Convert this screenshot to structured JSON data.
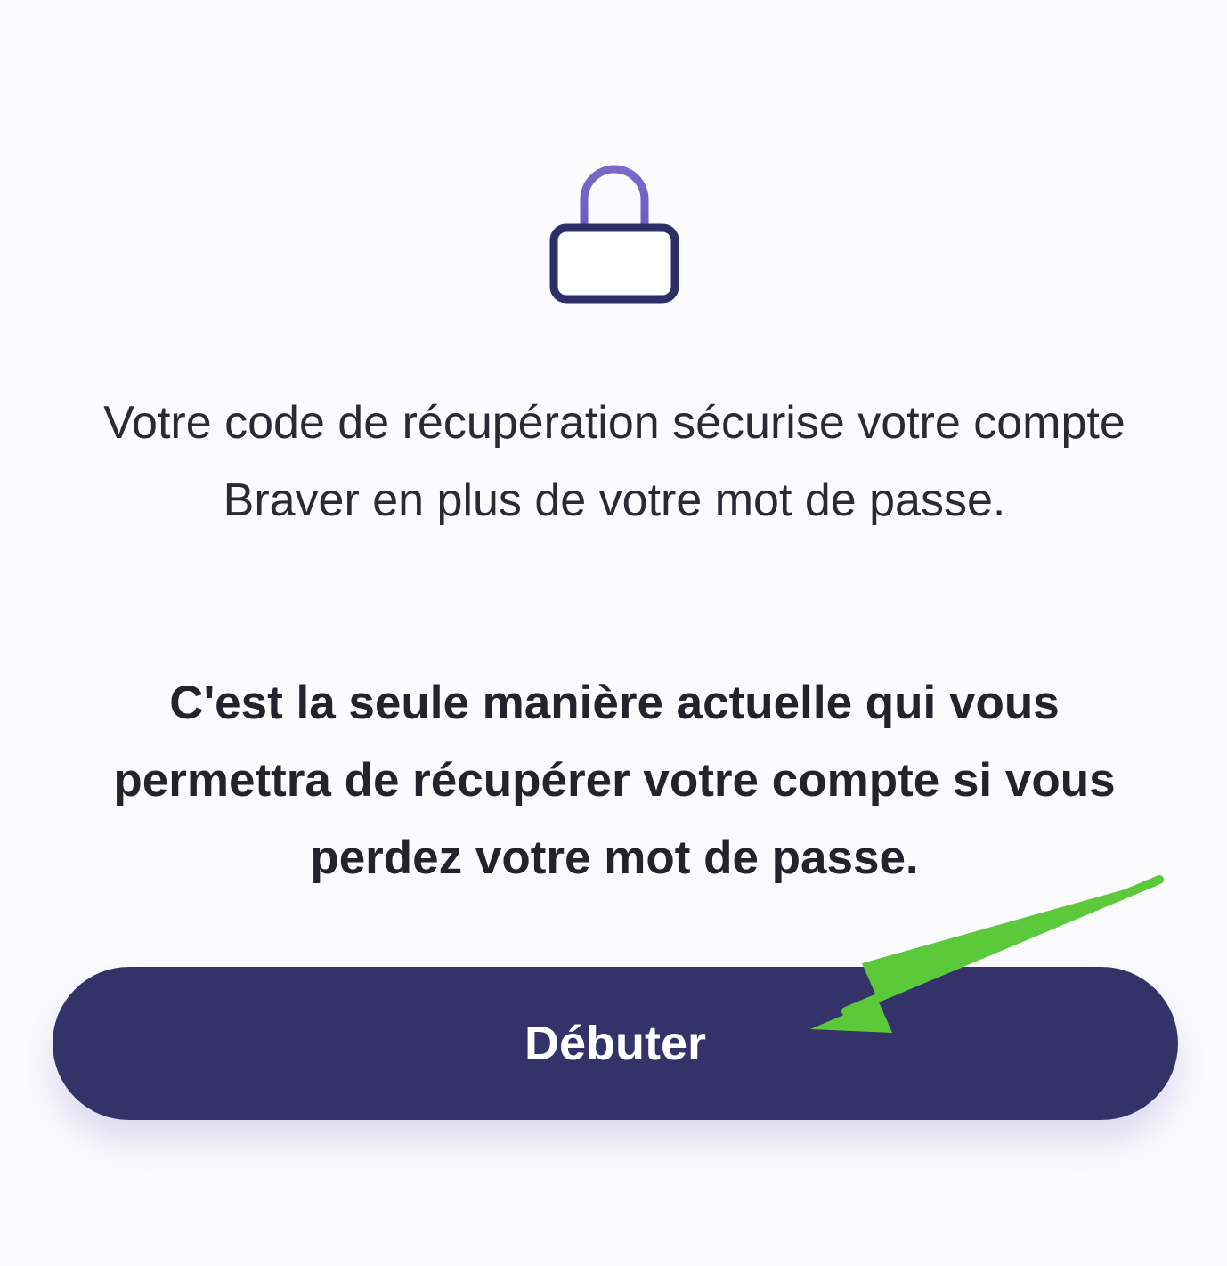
{
  "screen": {
    "icon": "lock-icon",
    "description": "Votre code de récupération sécurise votre compte Braver en plus de votre mot de passe.",
    "warning": "C'est la seule manière actuelle qui vous permettra de récupérer votre compte si vous perdez votre mot de passe.",
    "start_button_label": "Débuter"
  },
  "colors": {
    "background": "#fbfbfe",
    "button": "#33336a",
    "lock_body": "#2e2e66",
    "lock_shackle": "#7b68c9",
    "annotation_arrow": "#5cc93b"
  }
}
